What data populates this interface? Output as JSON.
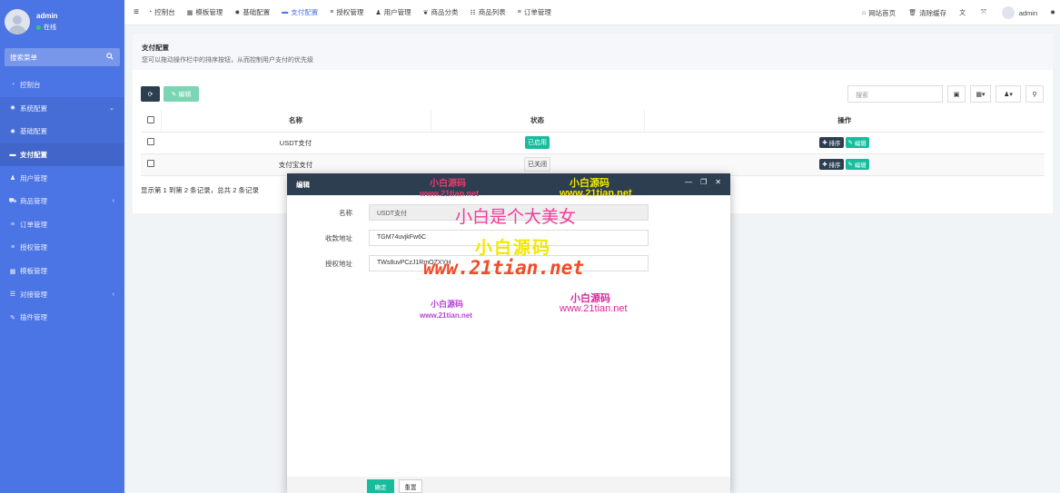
{
  "sidebar": {
    "user": {
      "name": "admin",
      "status": "在线"
    },
    "search_label": "搜索菜单",
    "items": [
      {
        "icon": "dashboard-icon",
        "label": "控制台"
      },
      {
        "icon": "gear-icon",
        "label": "系统配置"
      },
      {
        "icon": "gear-icon",
        "label": "基础配置"
      },
      {
        "icon": "card-icon",
        "label": "支付配置"
      },
      {
        "icon": "user-icon",
        "label": "用户管理"
      },
      {
        "icon": "cart-icon",
        "label": "商品管理"
      },
      {
        "icon": "list-icon",
        "label": "订单管理"
      },
      {
        "icon": "list-icon",
        "label": "授权管理"
      },
      {
        "icon": "template-icon",
        "label": "模板管理"
      },
      {
        "icon": "connect-icon",
        "label": "对接管理"
      },
      {
        "icon": "plugin-icon",
        "label": "插件管理"
      }
    ]
  },
  "topnav": {
    "items": [
      {
        "icon": "dashboard-icon",
        "label": "控制台"
      },
      {
        "icon": "template-icon",
        "label": "模板管理"
      },
      {
        "icon": "gear-icon",
        "label": "基础配置"
      },
      {
        "icon": "card-icon",
        "label": "支付配置"
      },
      {
        "icon": "list-icon",
        "label": "授权管理"
      },
      {
        "icon": "user-icon",
        "label": "用户管理"
      },
      {
        "icon": "leaf-icon",
        "label": "商品分类"
      },
      {
        "icon": "list-icon",
        "label": "商品列表"
      },
      {
        "icon": "list-icon",
        "label": "订单管理"
      }
    ],
    "right": {
      "home": "网站首页",
      "clear_cache": "清除缓存",
      "user": "admin"
    }
  },
  "panel": {
    "title": "支付配置",
    "desc": "您可以拖动操作栏中的排序按钮，从而控制用户支付的优先级",
    "edit_label": "编辑",
    "search_placeholder": "搜索",
    "columns": [
      "名称",
      "状态",
      "操作"
    ],
    "rows": [
      {
        "name": "USDT支付",
        "status": "已启用",
        "status_on": true
      },
      {
        "name": "支付宝支付",
        "status": "已关闭",
        "status_on": false
      }
    ],
    "sort_label": "排序",
    "row_edit_label": "编辑",
    "pager": "显示第 1 到第 2 条记录，总共 2 条记录"
  },
  "modal": {
    "title": "编辑",
    "fields": [
      {
        "label": "名称",
        "value": "USDT支付"
      },
      {
        "label": "收款地址",
        "value": "TGM74uvjkFw6C"
      },
      {
        "label": "授权地址",
        "value": "TWs8uvPCzJ1RmOZXYH"
      }
    ],
    "ok_label": "确定",
    "reset_label": "重置"
  },
  "watermarks": {
    "w1": "小白源码",
    "w2": "www.21tian.net",
    "w3": "小白源码",
    "w4": "www.21tian.net",
    "w5": "小白是个大美女",
    "w6": "小白源码",
    "w7": "www.21tian.net",
    "w8": "小白源码",
    "w9": "www.21tian.net",
    "w10": "小白源码",
    "w11": "www.21tian.net"
  },
  "colors": {
    "sidebar": "#4b74e4",
    "dark": "#2c3e50",
    "green": "#18bc9c"
  }
}
